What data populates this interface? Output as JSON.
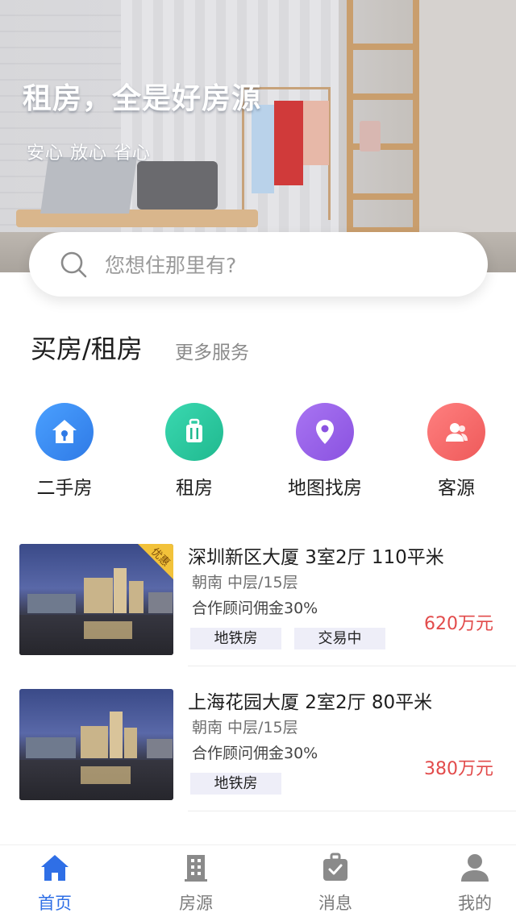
{
  "hero": {
    "title": "租房，全是好房源",
    "subtitle": "安心 放心  省心"
  },
  "search": {
    "placeholder": "您想住那里有?"
  },
  "section": {
    "title": "买房/租房",
    "more": "更多服务"
  },
  "categories": [
    {
      "label": "二手房",
      "icon": "house-key-icon",
      "color": "#3a8ef0"
    },
    {
      "label": "租房",
      "icon": "suitcase-icon",
      "color": "#2ec9a0"
    },
    {
      "label": "地图找房",
      "icon": "map-pin-icon",
      "color": "#9a63ea"
    },
    {
      "label": "客源",
      "icon": "users-icon",
      "color": "#f06b6b"
    }
  ],
  "listings": [
    {
      "title": "深圳新区大厦  3室2厅 110平米",
      "meta": "朝南  中层/15层",
      "commission": "合作顾问佣金30%",
      "tags": [
        "地铁房",
        "交易中"
      ],
      "price": "620万元",
      "badge": "优惠"
    },
    {
      "title": "上海花园大厦  2室2厅 80平米",
      "meta": "朝南  中层/15层",
      "commission": "合作顾问佣金30%",
      "tags": [
        "地铁房"
      ],
      "price": "380万元"
    }
  ],
  "tabbar": [
    {
      "label": "首页",
      "icon": "home-icon",
      "active": true
    },
    {
      "label": "房源",
      "icon": "building-icon",
      "active": false
    },
    {
      "label": "消息",
      "icon": "message-bag-icon",
      "active": false
    },
    {
      "label": "我的",
      "icon": "profile-icon",
      "active": false
    }
  ],
  "colors": {
    "accent": "#2f6fe6",
    "price": "#e24b4b"
  }
}
